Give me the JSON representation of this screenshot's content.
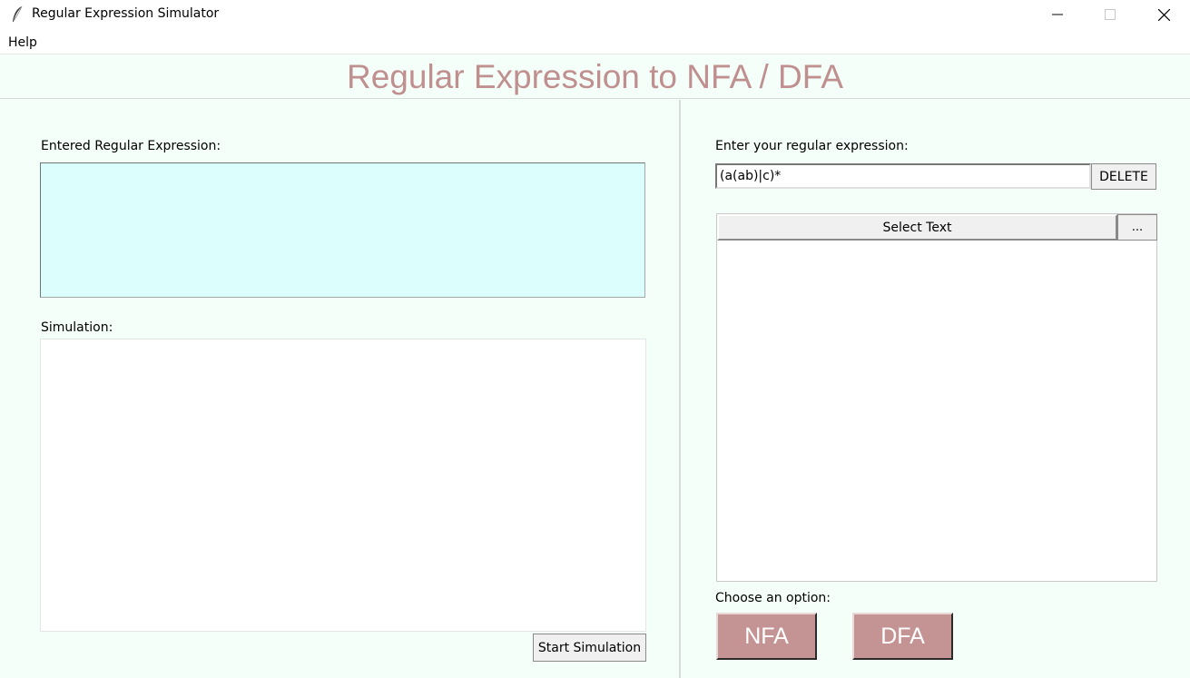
{
  "window": {
    "title": "Regular Expression Simulator"
  },
  "menu": {
    "help": "Help"
  },
  "header": {
    "title": "Regular Expression to NFA / DFA"
  },
  "left": {
    "entered_label": "Entered Regular Expression:",
    "entered_value": "",
    "simulation_label": "Simulation:",
    "simulation_value": "",
    "start_button": "Start Simulation"
  },
  "right": {
    "input_label": "Enter your regular expression:",
    "input_value": "(a(ab)|c)*",
    "delete_button": "DELETE",
    "select_button": "Select Text",
    "more_button": "...",
    "option_label": "Choose an option:",
    "nfa_button": "NFA",
    "dfa_button": "DFA"
  },
  "colors": {
    "title_color": "#c09090",
    "panel_bg": "#f4fff9",
    "regex_display_bg": "#dcfefd",
    "option_button_bg": "#c49494"
  }
}
